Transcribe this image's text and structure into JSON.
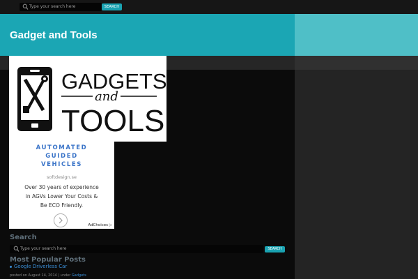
{
  "top_search": {
    "placeholder": "Type your search here",
    "button": "SEARCH"
  },
  "header": {
    "site_title": "Gadget and Tools"
  },
  "logo": {
    "text_gadgets": "GADGETS",
    "text_and": "and",
    "text_tools": "TOOLS",
    "icon": "phone-tools-icon"
  },
  "ad": {
    "headline": [
      "AUTOMATED",
      "GUIDED",
      "VEHICLES"
    ],
    "domain": "softdesign.se",
    "body": [
      "Over 30 years of experience",
      "in AGVs Lower Your Costs &",
      "Be ECO Friendly."
    ],
    "adchoices": "AdChoices"
  },
  "search_widget": {
    "title": "Search",
    "placeholder": "Type your search here",
    "button": "SEARCH"
  },
  "popular": {
    "title": "Most Popular Posts",
    "items": [
      {
        "title": "Google Driverless Car",
        "meta_prefix": "posted on August 14, 2014 | under",
        "category": "Gadgets"
      }
    ]
  },
  "colors": {
    "accent": "#1ba6b4",
    "header_right": "#4fbfc7",
    "link": "#3a8fd8",
    "background": "#0b0b0b",
    "sidebar": "#242424"
  }
}
